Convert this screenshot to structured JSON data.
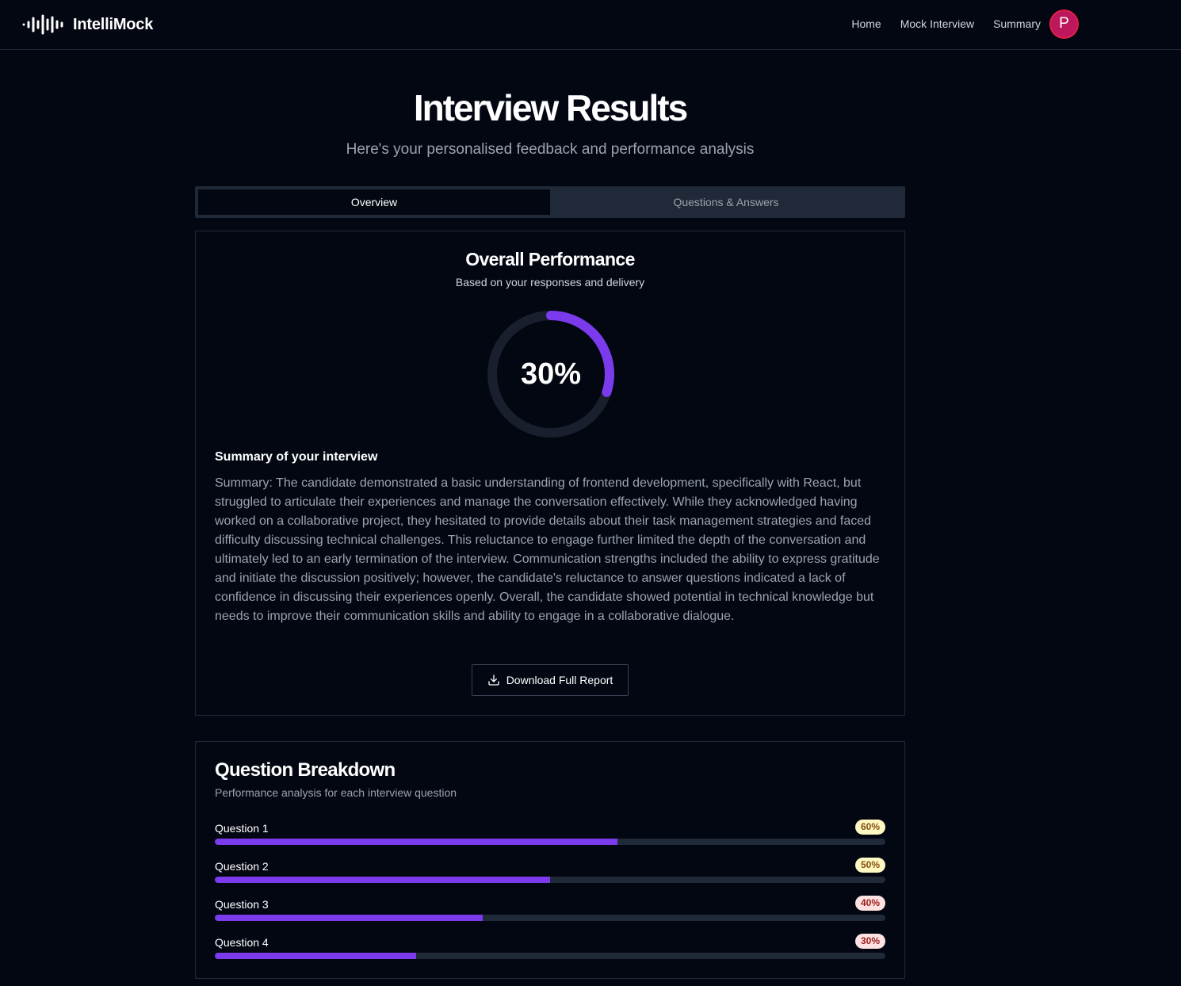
{
  "navbar": {
    "brand": "IntelliMock",
    "links": [
      "Home",
      "Mock Interview",
      "Summary"
    ],
    "avatar_initial": "P"
  },
  "header": {
    "title": "Interview Results",
    "subtitle": "Here's your personalised feedback and performance analysis"
  },
  "tabs": [
    {
      "label": "Overview",
      "active": true
    },
    {
      "label": "Questions & Answers",
      "active": false
    }
  ],
  "overall": {
    "title": "Overall Performance",
    "subtitle": "Based on your responses and delivery",
    "score_percent": 30,
    "score_label": "30%",
    "accent_color": "#7c3aed",
    "summary_heading": "Summary of your interview",
    "summary_text": "Summary: The candidate demonstrated a basic understanding of frontend development, specifically with React, but struggled to articulate their experiences and manage the conversation effectively. While they acknowledged having worked on a collaborative project, they hesitated to provide details about their task management strategies and faced difficulty discussing technical challenges. This reluctance to engage further limited the depth of the conversation and ultimately led to an early termination of the interview. Communication strengths included the ability to express gratitude and initiate the discussion positively; however, the candidate's reluctance to answer questions indicated a lack of confidence in discussing their experiences openly. Overall, the candidate showed potential in technical knowledge but needs to improve their communication skills and ability to engage in a collaborative dialogue.",
    "download_label": "Download Full Report",
    "download_icon": "download-icon"
  },
  "breakdown": {
    "title": "Question Breakdown",
    "subtitle": "Performance analysis for each interview question",
    "questions": [
      {
        "label": "Question 1",
        "score_label": "60%",
        "score": 0.6,
        "level": "mid"
      },
      {
        "label": "Question 2",
        "score_label": "50%",
        "score": 0.5,
        "level": "mid"
      },
      {
        "label": "Question 3",
        "score_label": "40%",
        "score": 0.4,
        "level": "low"
      },
      {
        "label": "Question 4",
        "score_label": "30%",
        "score": 0.3,
        "level": "low"
      }
    ]
  }
}
